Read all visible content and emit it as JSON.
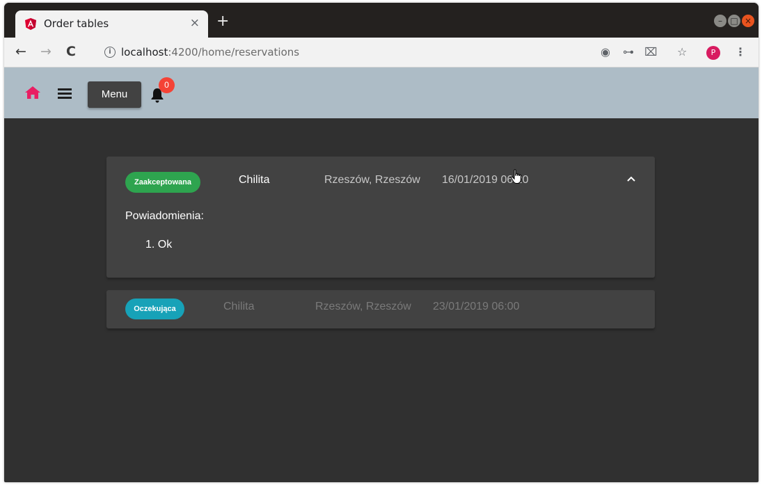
{
  "browser": {
    "tab_title": "Order tables",
    "tab_close": "×",
    "new_tab": "+",
    "url_host": "localhost",
    "url_path": ":4200/home/reservations",
    "profile_initial": "P",
    "icons": [
      "location-icon",
      "key-icon",
      "translate-icon",
      "star-icon",
      "more-icon"
    ]
  },
  "header": {
    "menu_label": "Menu",
    "notification_count": "0",
    "colors": {
      "header_bg": "#adbcc6",
      "home": "#e91e63",
      "badge": "#f44336"
    }
  },
  "reservations": [
    {
      "status": "Zaakceptowana",
      "status_color": "#2ea44f",
      "restaurant": "Chilita",
      "location": "Rzeszów, Rzeszów",
      "datetime": "16/01/2019 06:20",
      "expanded": true,
      "notifications_label": "Powiadomienia:",
      "notifications": [
        "1. Ok"
      ]
    },
    {
      "status": "Oczekująca",
      "status_color": "#17a2b8",
      "restaurant": "Chilita",
      "location": "Rzeszów, Rzeszów",
      "datetime": "23/01/2019 06:00",
      "expanded": false
    }
  ]
}
